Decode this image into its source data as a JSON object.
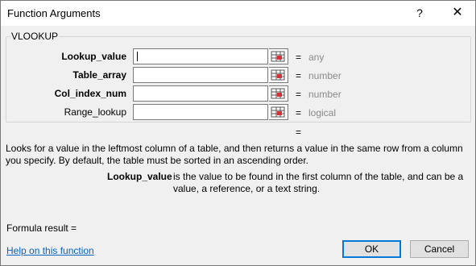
{
  "window": {
    "title": "Function Arguments",
    "help_glyph": "?",
    "close_glyph": "✕"
  },
  "function": {
    "name": "VLOOKUP"
  },
  "arguments": [
    {
      "label": "Lookup_value",
      "value": "",
      "eq": "=",
      "hint": "any",
      "bold": true
    },
    {
      "label": "Table_array",
      "value": "",
      "eq": "=",
      "hint": "number",
      "bold": true
    },
    {
      "label": "Col_index_num",
      "value": "",
      "eq": "=",
      "hint": "number",
      "bold": true
    },
    {
      "label": "Range_lookup",
      "value": "",
      "eq": "=",
      "hint": "logical",
      "bold": false
    }
  ],
  "result_eq": "=",
  "description": "Looks for a value in the leftmost column of a table, and then returns a value in the same row from a column you specify. By default, the table must be sorted in an ascending order.",
  "current_arg": {
    "name": "Lookup_value",
    "description": "is the value to be found in the first column of the table, and can be a value, a reference, or a text string."
  },
  "formula_result": "Formula result =",
  "help_link": "Help on this function",
  "buttons": {
    "ok": "OK",
    "cancel": "Cancel"
  },
  "colors": {
    "link": "#0563c1",
    "hint": "#8a8a8a",
    "ok_border": "#0078d7",
    "background": "#f0f0f0"
  }
}
